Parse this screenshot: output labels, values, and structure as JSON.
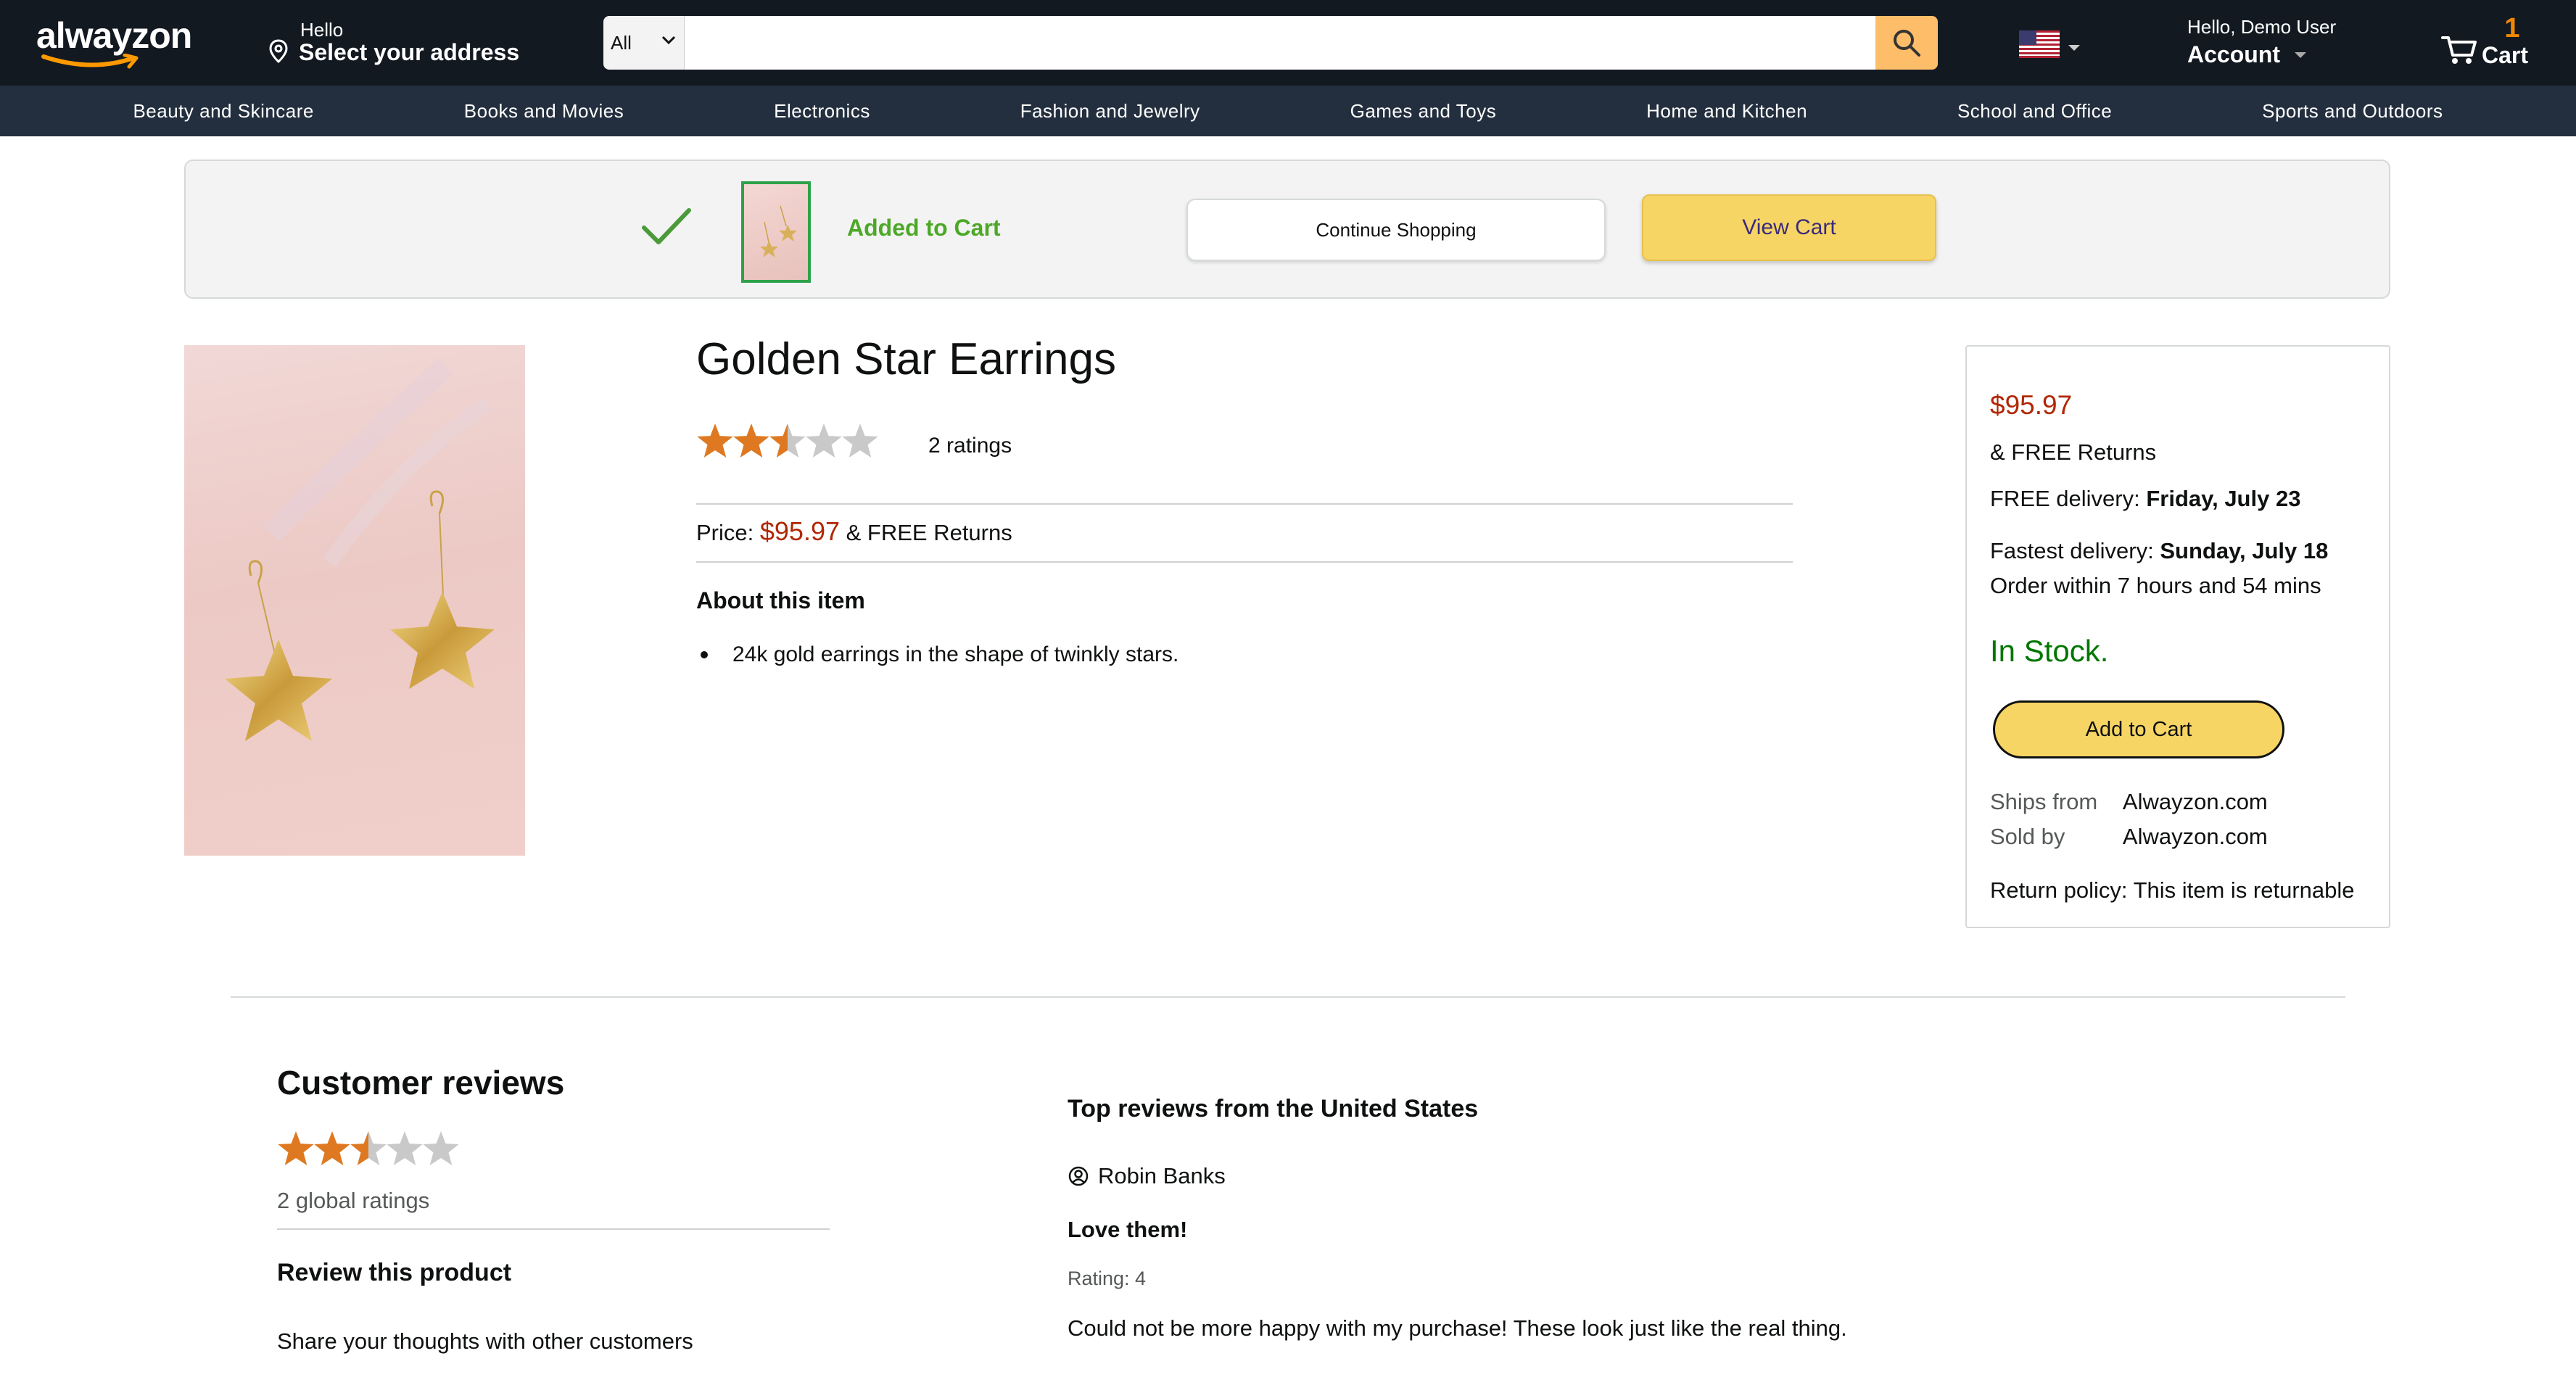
{
  "header": {
    "logo_text": "alwayzon",
    "deliver_hello": "Hello",
    "deliver_address": "Select your address",
    "search_category": "All",
    "search_placeholder": "",
    "account_hello": "Hello, Demo User",
    "account_label": "Account",
    "cart_count": "1",
    "cart_label": "Cart"
  },
  "nav": {
    "categories": [
      "Beauty and Skincare",
      "Books and Movies",
      "Electronics",
      "Fashion and Jewelry",
      "Games and Toys",
      "Home and Kitchen",
      "School and Office",
      "Sports and Outdoors"
    ]
  },
  "banner": {
    "added_text": "Added to Cart",
    "continue_label": "Continue Shopping",
    "view_cart_label": "View Cart"
  },
  "product": {
    "title": "Golden Star Earrings",
    "rating_value": 2.5,
    "rating_max": 5,
    "ratings_count": "2 ratings",
    "price_label": "Price:",
    "price": "$95.97",
    "price_suffix": "& FREE Returns",
    "about_heading": "About this item",
    "bullets": [
      "24k gold earrings in the shape of twinkly stars."
    ]
  },
  "buybox": {
    "price": "$95.97",
    "free_returns": "& FREE Returns",
    "free_delivery_label": "FREE delivery:",
    "free_delivery_date": "Friday, July 23",
    "fastest_label": "Fastest delivery:",
    "fastest_date": "Sunday, July 18",
    "order_within": "Order within 7 hours and 54 mins",
    "stock": "In Stock.",
    "add_to_cart": "Add to Cart",
    "ships_from_label": "Ships from",
    "ships_from_value": "Alwayzon.com",
    "sold_by_label": "Sold by",
    "sold_by_value": "Alwayzon.com",
    "return_policy": "Return policy: This item is returnable"
  },
  "reviews": {
    "heading": "Customer reviews",
    "global_ratings": "2 global ratings",
    "review_product_heading": "Review this product",
    "share_text": "Share your thoughts with other customers",
    "top_heading": "Top reviews from the United States",
    "items": [
      {
        "author": "Robin Banks",
        "title": "Love them!",
        "rating_text": "Rating: 4",
        "body": "Could not be more happy with my purchase! These look just like the real thing."
      }
    ]
  },
  "colors": {
    "header_bg": "#131921",
    "nav_bg": "#232f3e",
    "price_red": "#b12704",
    "stock_green": "#007600",
    "star_orange": "#de7921",
    "button_yellow": "#f7d565",
    "added_green": "#4da828"
  }
}
